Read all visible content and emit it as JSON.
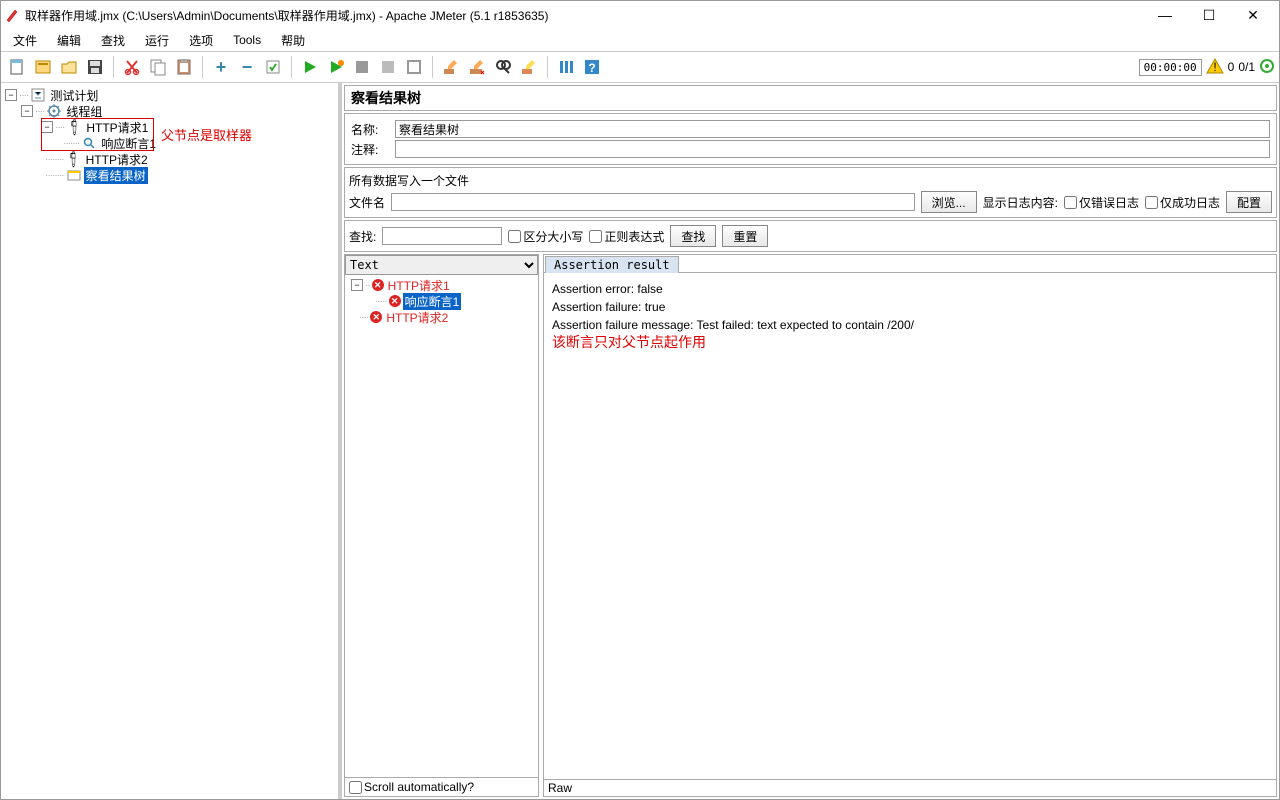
{
  "window": {
    "title": "取样器作用域.jmx (C:\\Users\\Admin\\Documents\\取样器作用域.jmx) - Apache JMeter (5.1 r1853635)"
  },
  "menus": {
    "file": "文件",
    "edit": "编辑",
    "search": "查找",
    "run": "运行",
    "options": "选项",
    "tools": "Tools",
    "help": "帮助"
  },
  "tree": {
    "plan": "测试计划",
    "threadgroup": "线程组",
    "req1": "HTTP请求1",
    "assert1": "响应断言1",
    "req2": "HTTP请求2",
    "view": "察看结果树",
    "annot": "父节点是取样器"
  },
  "panel": {
    "title": "察看结果树",
    "name_label": "名称:",
    "name_value": "察看结果树",
    "comment_label": "注释:",
    "file_group": "所有数据写入一个文件",
    "filename_label": "文件名",
    "browse": "浏览...",
    "logshow_label": "显示日志内容:",
    "only_err": "仅错误日志",
    "only_ok": "仅成功日志",
    "configure": "配置"
  },
  "search": {
    "label": "查找:",
    "case": "区分大小写",
    "regex": "正则表达式",
    "find": "查找",
    "reset": "重置"
  },
  "results": {
    "mode": "Text",
    "tab": "Assertion result",
    "nodes": {
      "r1": "HTTP请求1",
      "fail": "响应断言1",
      "r2": "HTTP请求2"
    },
    "body_line1": "Assertion error: false",
    "body_line2": "Assertion failure: true",
    "body_line3": "Assertion failure message: Test failed: text expected to contain /200/",
    "red_msg": "该断言只对父节点起作用",
    "scroll": "Scroll automatically?",
    "raw": "Raw"
  },
  "status": {
    "time": "00:00:00",
    "threads": "0",
    "ratio": "0/1"
  }
}
